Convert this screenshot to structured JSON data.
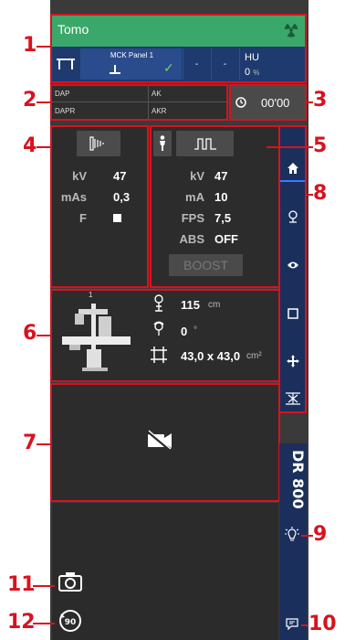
{
  "callouts": [
    "1",
    "2",
    "3",
    "4",
    "5",
    "6",
    "7",
    "8",
    "9",
    "10",
    "11",
    "12"
  ],
  "header": {
    "title": "Tomo"
  },
  "panel": {
    "detector_name": "MCK Panel 1",
    "status_check": "✓",
    "slot_a": "-",
    "slot_b": "-",
    "hu_label": "HU",
    "hu_value": "0",
    "hu_unit": "%"
  },
  "dose": {
    "dap_label": "DAP",
    "ak_label": "AK",
    "dapr_label": "DAPR",
    "akr_label": "AKR"
  },
  "timer": {
    "value": "00'00"
  },
  "radiography": {
    "kv_label": "kV",
    "kv_value": "47",
    "mas_label": "mAs",
    "mas_value": "0,3",
    "f_label": "F"
  },
  "fluoro": {
    "kv_label": "kV",
    "kv_value": "47",
    "ma_label": "mA",
    "ma_value": "10",
    "fps_label": "FPS",
    "fps_value": "7,5",
    "abs_label": "ABS",
    "abs_value": "OFF",
    "boost_label": "BOOST"
  },
  "geometry": {
    "position_index": "1",
    "sid_value": "115",
    "sid_unit": "cm",
    "angle_value": "0",
    "angle_unit": "°",
    "field_value": "43,0 x 43,0",
    "field_unit": "cm²"
  },
  "system": {
    "name": "DR 800"
  },
  "colors": {
    "header_green": "#3aa86a",
    "panel_blue": "#1f3a6e",
    "sidebar_blue": "#1b2f5c",
    "callout_red": "#d8121f",
    "panel_bg": "#2c2c2c"
  }
}
